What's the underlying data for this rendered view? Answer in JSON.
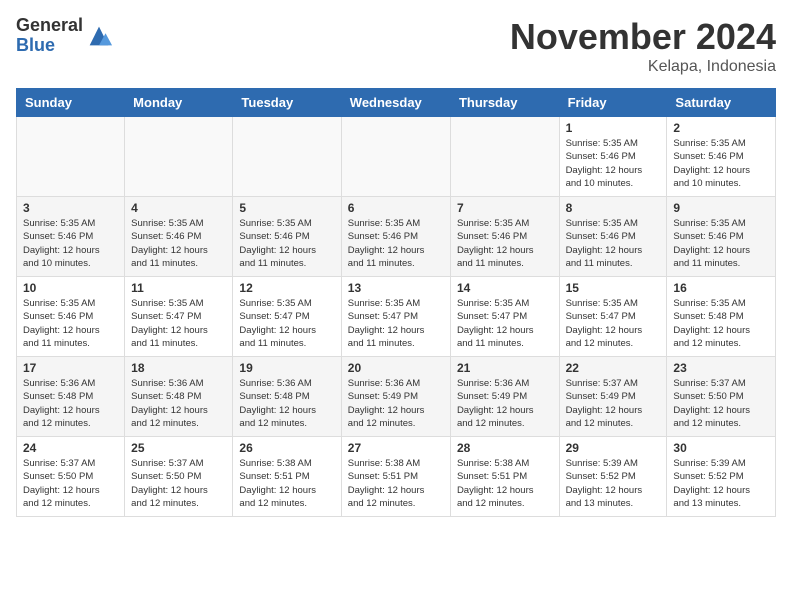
{
  "logo": {
    "general": "General",
    "blue": "Blue"
  },
  "header": {
    "title": "November 2024",
    "location": "Kelapa, Indonesia"
  },
  "weekdays": [
    "Sunday",
    "Monday",
    "Tuesday",
    "Wednesday",
    "Thursday",
    "Friday",
    "Saturday"
  ],
  "weeks": [
    [
      {
        "day": "",
        "info": ""
      },
      {
        "day": "",
        "info": ""
      },
      {
        "day": "",
        "info": ""
      },
      {
        "day": "",
        "info": ""
      },
      {
        "day": "",
        "info": ""
      },
      {
        "day": "1",
        "info": "Sunrise: 5:35 AM\nSunset: 5:46 PM\nDaylight: 12 hours\nand 10 minutes."
      },
      {
        "day": "2",
        "info": "Sunrise: 5:35 AM\nSunset: 5:46 PM\nDaylight: 12 hours\nand 10 minutes."
      }
    ],
    [
      {
        "day": "3",
        "info": "Sunrise: 5:35 AM\nSunset: 5:46 PM\nDaylight: 12 hours\nand 10 minutes."
      },
      {
        "day": "4",
        "info": "Sunrise: 5:35 AM\nSunset: 5:46 PM\nDaylight: 12 hours\nand 11 minutes."
      },
      {
        "day": "5",
        "info": "Sunrise: 5:35 AM\nSunset: 5:46 PM\nDaylight: 12 hours\nand 11 minutes."
      },
      {
        "day": "6",
        "info": "Sunrise: 5:35 AM\nSunset: 5:46 PM\nDaylight: 12 hours\nand 11 minutes."
      },
      {
        "day": "7",
        "info": "Sunrise: 5:35 AM\nSunset: 5:46 PM\nDaylight: 12 hours\nand 11 minutes."
      },
      {
        "day": "8",
        "info": "Sunrise: 5:35 AM\nSunset: 5:46 PM\nDaylight: 12 hours\nand 11 minutes."
      },
      {
        "day": "9",
        "info": "Sunrise: 5:35 AM\nSunset: 5:46 PM\nDaylight: 12 hours\nand 11 minutes."
      }
    ],
    [
      {
        "day": "10",
        "info": "Sunrise: 5:35 AM\nSunset: 5:46 PM\nDaylight: 12 hours\nand 11 minutes."
      },
      {
        "day": "11",
        "info": "Sunrise: 5:35 AM\nSunset: 5:47 PM\nDaylight: 12 hours\nand 11 minutes."
      },
      {
        "day": "12",
        "info": "Sunrise: 5:35 AM\nSunset: 5:47 PM\nDaylight: 12 hours\nand 11 minutes."
      },
      {
        "day": "13",
        "info": "Sunrise: 5:35 AM\nSunset: 5:47 PM\nDaylight: 12 hours\nand 11 minutes."
      },
      {
        "day": "14",
        "info": "Sunrise: 5:35 AM\nSunset: 5:47 PM\nDaylight: 12 hours\nand 11 minutes."
      },
      {
        "day": "15",
        "info": "Sunrise: 5:35 AM\nSunset: 5:47 PM\nDaylight: 12 hours\nand 12 minutes."
      },
      {
        "day": "16",
        "info": "Sunrise: 5:35 AM\nSunset: 5:48 PM\nDaylight: 12 hours\nand 12 minutes."
      }
    ],
    [
      {
        "day": "17",
        "info": "Sunrise: 5:36 AM\nSunset: 5:48 PM\nDaylight: 12 hours\nand 12 minutes."
      },
      {
        "day": "18",
        "info": "Sunrise: 5:36 AM\nSunset: 5:48 PM\nDaylight: 12 hours\nand 12 minutes."
      },
      {
        "day": "19",
        "info": "Sunrise: 5:36 AM\nSunset: 5:48 PM\nDaylight: 12 hours\nand 12 minutes."
      },
      {
        "day": "20",
        "info": "Sunrise: 5:36 AM\nSunset: 5:49 PM\nDaylight: 12 hours\nand 12 minutes."
      },
      {
        "day": "21",
        "info": "Sunrise: 5:36 AM\nSunset: 5:49 PM\nDaylight: 12 hours\nand 12 minutes."
      },
      {
        "day": "22",
        "info": "Sunrise: 5:37 AM\nSunset: 5:49 PM\nDaylight: 12 hours\nand 12 minutes."
      },
      {
        "day": "23",
        "info": "Sunrise: 5:37 AM\nSunset: 5:50 PM\nDaylight: 12 hours\nand 12 minutes."
      }
    ],
    [
      {
        "day": "24",
        "info": "Sunrise: 5:37 AM\nSunset: 5:50 PM\nDaylight: 12 hours\nand 12 minutes."
      },
      {
        "day": "25",
        "info": "Sunrise: 5:37 AM\nSunset: 5:50 PM\nDaylight: 12 hours\nand 12 minutes."
      },
      {
        "day": "26",
        "info": "Sunrise: 5:38 AM\nSunset: 5:51 PM\nDaylight: 12 hours\nand 12 minutes."
      },
      {
        "day": "27",
        "info": "Sunrise: 5:38 AM\nSunset: 5:51 PM\nDaylight: 12 hours\nand 12 minutes."
      },
      {
        "day": "28",
        "info": "Sunrise: 5:38 AM\nSunset: 5:51 PM\nDaylight: 12 hours\nand 12 minutes."
      },
      {
        "day": "29",
        "info": "Sunrise: 5:39 AM\nSunset: 5:52 PM\nDaylight: 12 hours\nand 13 minutes."
      },
      {
        "day": "30",
        "info": "Sunrise: 5:39 AM\nSunset: 5:52 PM\nDaylight: 12 hours\nand 13 minutes."
      }
    ]
  ]
}
